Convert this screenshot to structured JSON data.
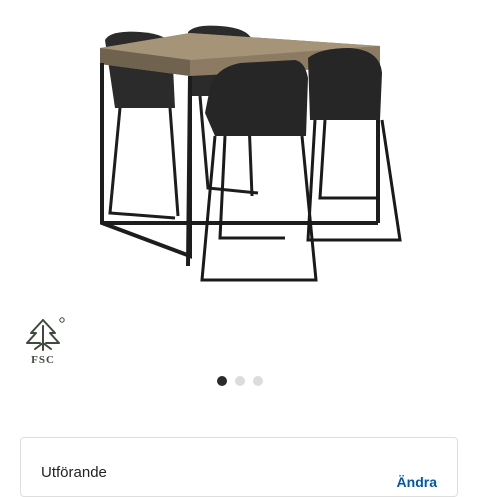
{
  "product": {
    "image_alt": "Bar table with four black bar chairs",
    "certification": "FSC"
  },
  "carousel": {
    "dots": 3,
    "active_index": 0
  },
  "variant": {
    "label": "Utförande",
    "action": "Ändra"
  },
  "colors": {
    "accent": "#0058a3",
    "dot_active": "#2b2b2b",
    "dot_inactive": "#dcdcdc"
  }
}
